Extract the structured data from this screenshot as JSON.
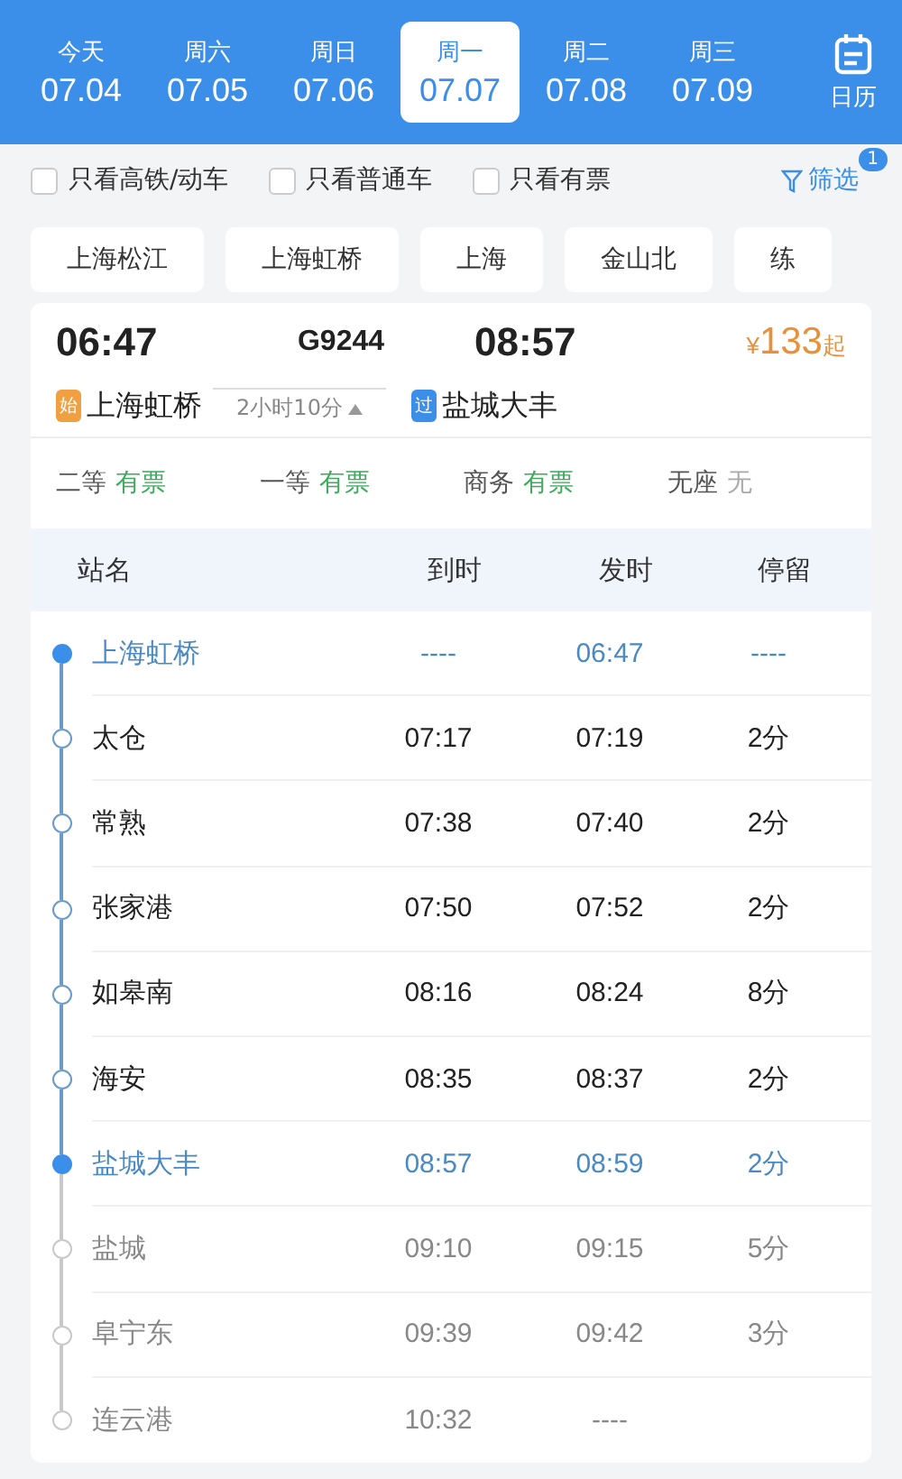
{
  "date_tabs": [
    {
      "weekday": "今天",
      "date": "07.04",
      "selected": false
    },
    {
      "weekday": "周六",
      "date": "07.05",
      "selected": false
    },
    {
      "weekday": "周日",
      "date": "07.06",
      "selected": false
    },
    {
      "weekday": "周一",
      "date": "07.07",
      "selected": true
    },
    {
      "weekday": "周二",
      "date": "07.08",
      "selected": false
    },
    {
      "weekday": "周三",
      "date": "07.09",
      "selected": false
    }
  ],
  "calendar_button": {
    "label": "日历"
  },
  "filters": [
    {
      "label": "只看高铁/动车",
      "checked": false
    },
    {
      "label": "只看普通车",
      "checked": false
    },
    {
      "label": "只看有票",
      "checked": false
    }
  ],
  "filter_button": {
    "label": "筛选",
    "badge": "1"
  },
  "station_chips": [
    "上海松江",
    "上海虹桥",
    "上海",
    "金山北",
    "练"
  ],
  "train": {
    "depart_time": "06:47",
    "number": "G9244",
    "arrive_time": "08:57",
    "price_symbol": "¥",
    "price": "133",
    "price_suffix": "起",
    "from_badge": "始",
    "from": "上海虹桥",
    "duration": "2小时10分",
    "to_badge": "过",
    "to": "盐城大丰",
    "seats": [
      {
        "class": "二等",
        "status": "有票",
        "available": true
      },
      {
        "class": "一等",
        "status": "有票",
        "available": true
      },
      {
        "class": "商务",
        "status": "有票",
        "available": true
      },
      {
        "class": "无座",
        "status": "无",
        "available": false
      }
    ]
  },
  "stop_table": {
    "columns": [
      "站名",
      "到时",
      "发时",
      "停留"
    ],
    "rows": [
      {
        "kind": "endpoint",
        "station": "上海虹桥",
        "arrive": "----",
        "depart": "06:47",
        "stop": "----"
      },
      {
        "kind": "normal",
        "station": "太仓",
        "arrive": "07:17",
        "depart": "07:19",
        "stop": "2分"
      },
      {
        "kind": "normal",
        "station": "常熟",
        "arrive": "07:38",
        "depart": "07:40",
        "stop": "2分"
      },
      {
        "kind": "normal",
        "station": "张家港",
        "arrive": "07:50",
        "depart": "07:52",
        "stop": "2分"
      },
      {
        "kind": "normal",
        "station": "如皋南",
        "arrive": "08:16",
        "depart": "08:24",
        "stop": "8分"
      },
      {
        "kind": "normal",
        "station": "海安",
        "arrive": "08:35",
        "depart": "08:37",
        "stop": "2分"
      },
      {
        "kind": "endpoint",
        "station": "盐城大丰",
        "arrive": "08:57",
        "depart": "08:59",
        "stop": "2分"
      },
      {
        "kind": "beyond",
        "station": "盐城",
        "arrive": "09:10",
        "depart": "09:15",
        "stop": "5分"
      },
      {
        "kind": "beyond",
        "station": "阜宁东",
        "arrive": "09:39",
        "depart": "09:42",
        "stop": "3分"
      },
      {
        "kind": "beyond",
        "station": "连云港",
        "arrive": "10:32",
        "depart": "----",
        "stop": ""
      }
    ]
  }
}
